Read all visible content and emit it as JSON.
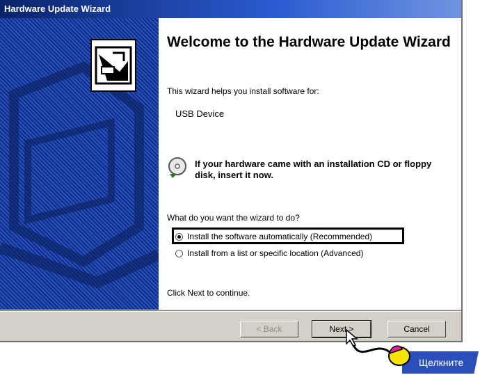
{
  "window": {
    "title": "Hardware Update Wizard"
  },
  "content": {
    "heading": "Welcome to the Hardware Update Wizard",
    "intro": "This wizard helps you install software for:",
    "device_name": "USB Device",
    "cd_notice": "If your hardware came with an installation CD or floppy disk, insert it now.",
    "question": "What do you want the wizard to do?",
    "options": [
      {
        "label": "Install the software automatically (Recommended)",
        "selected": true
      },
      {
        "label": "Install from a list or specific location (Advanced)",
        "selected": false
      }
    ],
    "continue_hint": "Click Next to continue."
  },
  "buttons": {
    "back": "< Back",
    "next": "Next >",
    "cancel": "Cancel"
  },
  "callout": {
    "label": "Щелкните"
  },
  "icons": {
    "wizard": "hardware-wizard-icon",
    "cd": "cd-disk-icon",
    "mouse": "mouse-icon",
    "cursor": "pointer-arrow-icon"
  }
}
